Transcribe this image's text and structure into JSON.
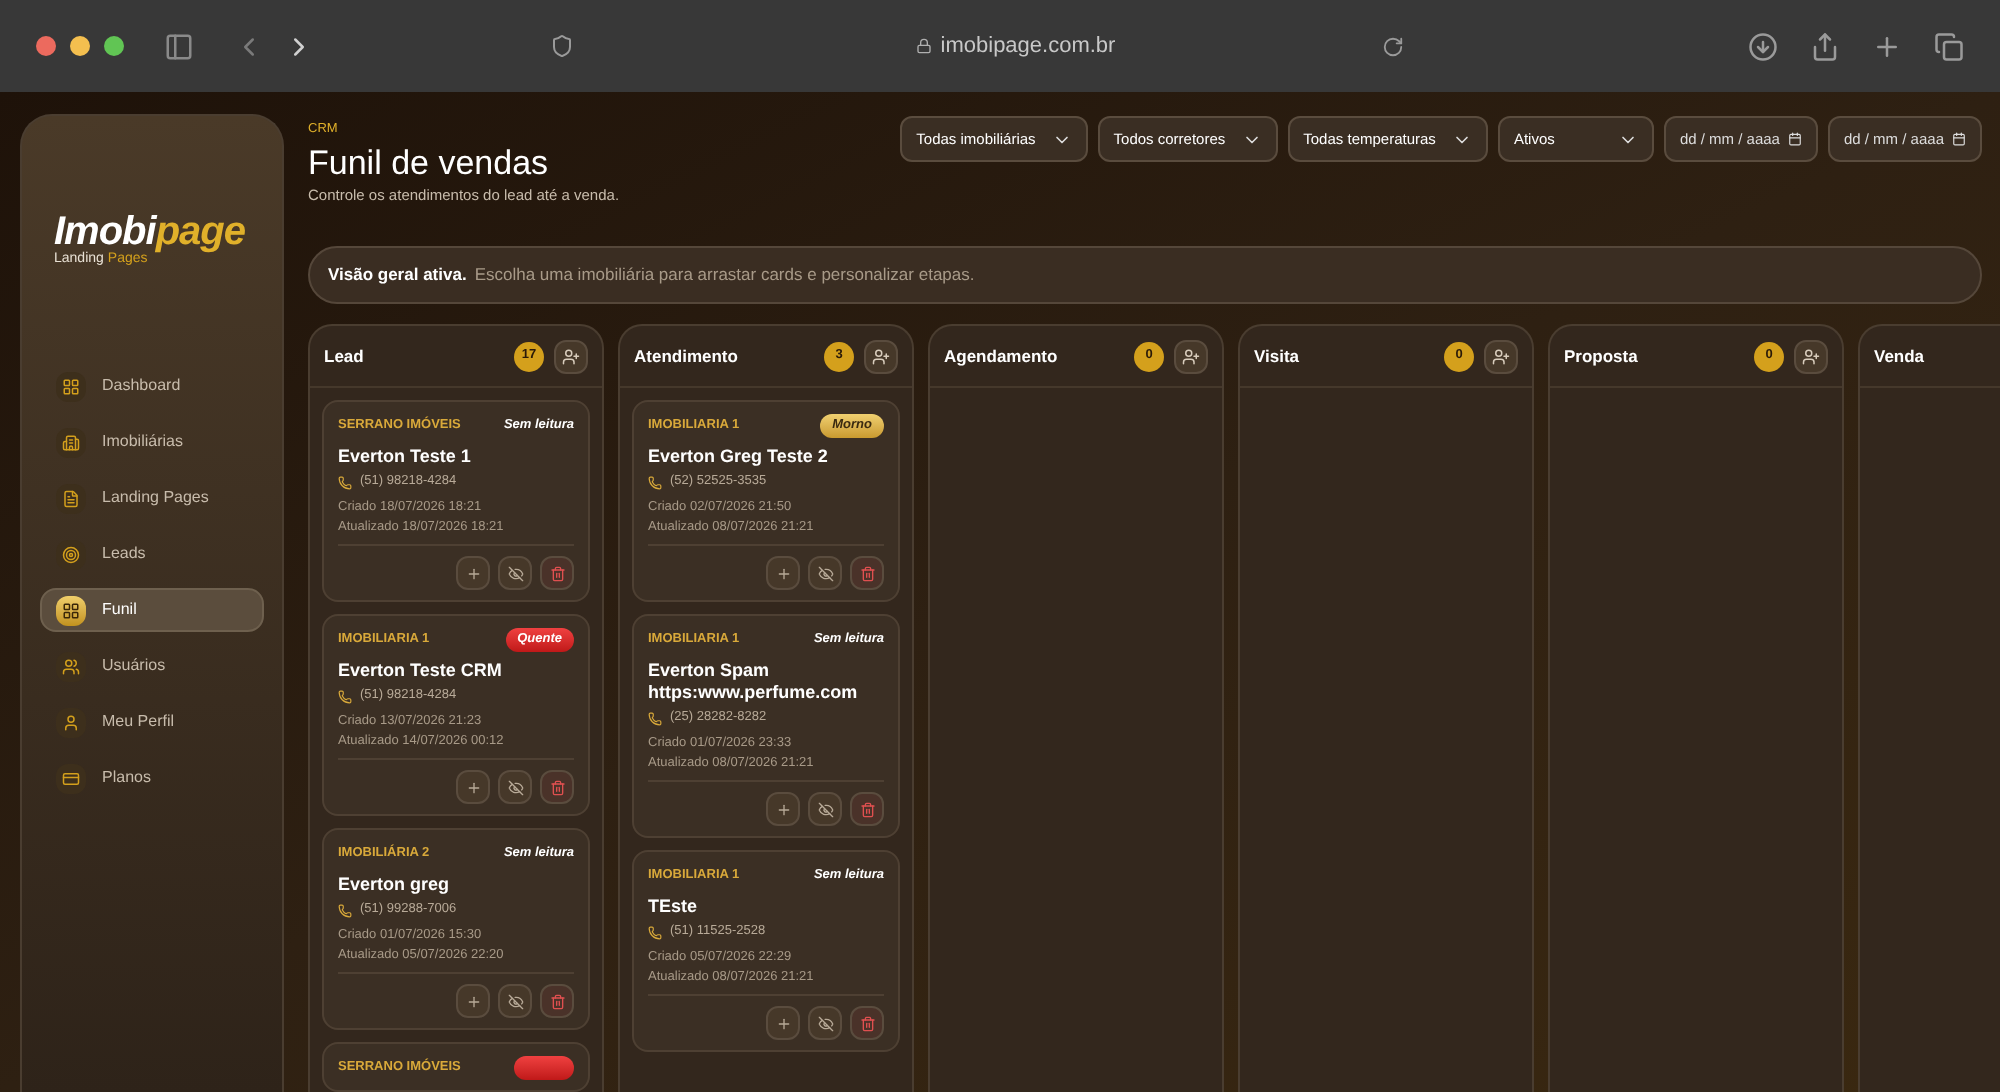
{
  "browser": {
    "url": "imobipage.com.br"
  },
  "sidebar": {
    "logo": {
      "part_1": "Imobi",
      "part_2": "page",
      "subtitle_1": "Landing",
      "subtitle_2": "Pages"
    },
    "items": [
      {
        "label": "Dashboard",
        "selected": false
      },
      {
        "label": "Imobiliárias",
        "selected": false
      },
      {
        "label": "Landing Pages",
        "selected": false
      },
      {
        "label": "Leads",
        "selected": false
      },
      {
        "label": "Funil",
        "selected": true
      },
      {
        "label": "Usuários",
        "selected": false
      },
      {
        "label": "Meu Perfil",
        "selected": false
      },
      {
        "label": "Planos",
        "selected": false
      }
    ]
  },
  "header": {
    "eyebrow": "CRM",
    "title": "Funil de vendas",
    "subtitle": "Controle os atendimentos do lead até a venda."
  },
  "filters": [
    {
      "kind": "select",
      "value": "Todas imobiliárias"
    },
    {
      "kind": "select",
      "value": "Todos corretores"
    },
    {
      "kind": "select",
      "value": "Todas temperaturas"
    },
    {
      "kind": "select",
      "value": "Ativos"
    },
    {
      "kind": "date",
      "placeholder": "dd / mm / aaaa"
    },
    {
      "kind": "date",
      "placeholder": "dd / mm / aaaa"
    }
  ],
  "banner": {
    "bold": "Visão geral ativa.",
    "text": "Escolha uma imobiliária para arrastar cards e personalizar etapas."
  },
  "columns": [
    {
      "title": "Lead",
      "count": "17",
      "cards": [
        {
          "agency": "SERRANO IMÓVEIS",
          "badge": {
            "kind": "plain",
            "text": "Sem leitura"
          },
          "name": "Everton Teste 1",
          "phone": "(51) 98218-4284",
          "created": "Criado 18/07/2026 18:21",
          "updated": "Atualizado 18/07/2026 18:21"
        },
        {
          "agency": "IMOBILIARIA 1",
          "badge": {
            "kind": "hot",
            "text": "Quente"
          },
          "name": "Everton Teste CRM",
          "phone": "(51) 98218-4284",
          "created": "Criado 13/07/2026 21:23",
          "updated": "Atualizado 14/07/2026 00:12"
        },
        {
          "agency": "IMOBILIÁRIA 2",
          "badge": {
            "kind": "plain",
            "text": "Sem leitura"
          },
          "name": "Everton greg",
          "phone": "(51) 99288-7006",
          "created": "Criado 01/07/2026 15:30",
          "updated": "Atualizado 05/07/2026 22:20"
        },
        {
          "agency": "SERRANO IMÓVEIS",
          "badge": {
            "kind": "hot"
          }
        }
      ]
    },
    {
      "title": "Atendimento",
      "count": "3",
      "cards": [
        {
          "agency": "IMOBILIARIA 1",
          "badge": {
            "kind": "warm",
            "text": "Morno"
          },
          "name": "Everton Greg Teste 2",
          "phone": "(52) 52525-3535",
          "created": "Criado 02/07/2026 21:50",
          "updated": "Atualizado 08/07/2026 21:21"
        },
        {
          "agency": "IMOBILIARIA 1",
          "badge": {
            "kind": "plain",
            "text": "Sem leitura"
          },
          "name": "Everton Spam https:www.perfume.com",
          "phone": "(25) 28282-8282",
          "created": "Criado 01/07/2026 23:33",
          "updated": "Atualizado 08/07/2026 21:21"
        },
        {
          "agency": "IMOBILIARIA 1",
          "badge": {
            "kind": "plain",
            "text": "Sem leitura"
          },
          "name": "TEste",
          "phone": "(51) 11525-2528",
          "created": "Criado 05/07/2026 22:29",
          "updated": "Atualizado 08/07/2026 21:21"
        }
      ]
    },
    {
      "title": "Agendamento",
      "count": "0"
    },
    {
      "title": "Visita",
      "count": "0"
    },
    {
      "title": "Proposta",
      "count": "0"
    },
    {
      "title": "Venda"
    }
  ]
}
